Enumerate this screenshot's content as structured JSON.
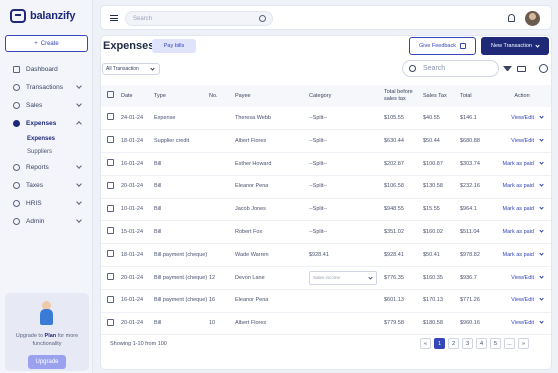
{
  "app": {
    "logo_text": "balanzify"
  },
  "sidebar": {
    "create_label": "Create",
    "items": [
      {
        "label": "Dashboard",
        "icon": "dashboard-icon",
        "has_chevron": false
      },
      {
        "label": "Transactions",
        "icon": "transactions-icon",
        "has_chevron": true
      },
      {
        "label": "Sales",
        "icon": "sales-icon",
        "has_chevron": true
      },
      {
        "label": "Expenses",
        "icon": "expenses-icon",
        "has_chevron": true,
        "active": true
      },
      {
        "label": "Reports",
        "icon": "reports-icon",
        "has_chevron": true
      },
      {
        "label": "Taxes",
        "icon": "taxes-icon",
        "has_chevron": true
      },
      {
        "label": "HRIS",
        "icon": "hris-icon",
        "has_chevron": true
      },
      {
        "label": "Admin",
        "icon": "admin-icon",
        "has_chevron": true
      }
    ],
    "subitems": [
      {
        "label": "Expenses",
        "active": true
      },
      {
        "label": "Suppliers",
        "active": false
      }
    ],
    "upgrade": {
      "prefix": "Upgrade to ",
      "plan": "Plan",
      "suffix": " for more functionality",
      "button_label": "Upgrade"
    }
  },
  "topbar": {
    "search_placeholder": "Search"
  },
  "page": {
    "title": "Expenses",
    "pay_bills_label": "Pay bills",
    "give_feedback_label": "Give Feedback",
    "new_transaction_label": "New Transaction",
    "filter_value": "All Transaction",
    "search_placeholder": "Search"
  },
  "table": {
    "columns": [
      "Date",
      "Type",
      "No.",
      "Payee",
      "Category",
      "Total before sales tax",
      "Sales Tax",
      "Total",
      "Action"
    ],
    "rows": [
      {
        "date": "24-01-24",
        "type": "Expense",
        "no": "",
        "payee": "Theresa Webb",
        "category": "--Split--",
        "before_tax": "$105.55",
        "sales_tax": "$40.55",
        "total": "$146.1",
        "action": "View/Edit"
      },
      {
        "date": "18-01-24",
        "type": "Supplier credit",
        "no": "",
        "payee": "Albert Flores",
        "category": "--Split--",
        "before_tax": "$630.44",
        "sales_tax": "$50.44",
        "total": "$680.88",
        "action": "View/Edit"
      },
      {
        "date": "16-01-24",
        "type": "Bill",
        "no": "",
        "payee": "Esther Howard",
        "category": "--Split--",
        "before_tax": "$202.87",
        "sales_tax": "$100.87",
        "total": "$303.74",
        "action": "Mark as paid"
      },
      {
        "date": "20-01-24",
        "type": "Bill",
        "no": "",
        "payee": "Eleanor Pena",
        "category": "--Split--",
        "before_tax": "$106.58",
        "sales_tax": "$130.58",
        "total": "$232.16",
        "action": "Mark as paid"
      },
      {
        "date": "10-01-24",
        "type": "Bill",
        "no": "",
        "payee": "Jacob Jones",
        "category": "--Split--",
        "before_tax": "$948.55",
        "sales_tax": "$15.55",
        "total": "$964.1",
        "action": "Mark as paid"
      },
      {
        "date": "15-01-24",
        "type": "Bill",
        "no": "",
        "payee": "Robert Fox",
        "category": "--Split--",
        "before_tax": "$351.02",
        "sales_tax": "$160.02",
        "total": "$511.04",
        "action": "Mark as paid"
      },
      {
        "date": "18-01-24",
        "type": "Bill payment (cheque)",
        "no": "",
        "payee": "Wade Warren",
        "category": "$928.41",
        "before_tax": "$928.41",
        "sales_tax": "$50.41",
        "total": "$978.82",
        "action": "Mark as paid"
      },
      {
        "date": "20-01-24",
        "type": "Bill payment (cheque)",
        "no": "12",
        "payee": "Devon Lane",
        "category_select": "Sales income",
        "before_tax": "$776.35",
        "sales_tax": "$160.35",
        "total": "$936.7",
        "action": "View/Edit"
      },
      {
        "date": "16-01-24",
        "type": "Bill payment (cheque)",
        "no": "16",
        "payee": "Eleanor Pena",
        "category": "",
        "before_tax": "$601.13",
        "sales_tax": "$170.13",
        "total": "$771.26",
        "action": "View/Edit"
      },
      {
        "date": "20-01-24",
        "type": "Bill",
        "no": "10",
        "payee": "Albert Flores",
        "category": "",
        "before_tax": "$779.58",
        "sales_tax": "$180.58",
        "total": "$960.16",
        "action": "View/Edit"
      }
    ]
  },
  "footer": {
    "showing_text": "Showing 1-10 from 100",
    "pages": [
      "1",
      "2",
      "3",
      "4",
      "5",
      "..."
    ]
  },
  "colors": {
    "primary": "#1e2a78",
    "accent": "#3446b8",
    "background": "#eef1f8"
  }
}
